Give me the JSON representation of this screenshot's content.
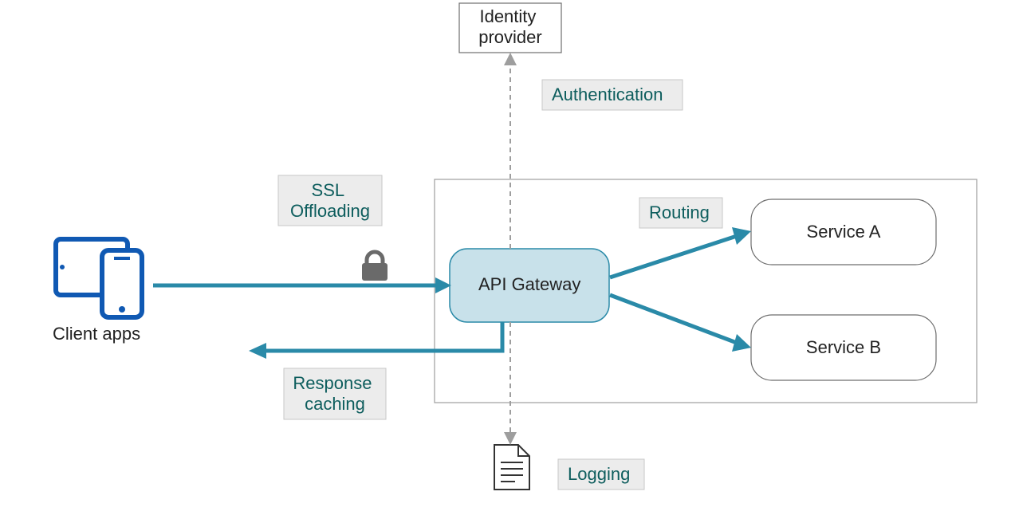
{
  "nodes": {
    "identity_provider": "Identity\nprovider",
    "client_apps": "Client apps",
    "api_gateway": "API Gateway",
    "service_a": "Service A",
    "service_b": "Service B"
  },
  "tags": {
    "authentication": "Authentication",
    "ssl_offloading": "SSL\nOffloading",
    "routing": "Routing",
    "response_caching": "Response\ncaching",
    "logging": "Logging"
  },
  "colors": {
    "teal": "#2a8aa8",
    "tag_bg": "#ececec",
    "tag_border": "#c7c7c7",
    "tag_text": "#0d5d5d",
    "client_blue": "#1059b3",
    "gateway_fill": "#c8e1ea",
    "lock": "#6a6a6a",
    "outline": "#6d6d6d"
  }
}
